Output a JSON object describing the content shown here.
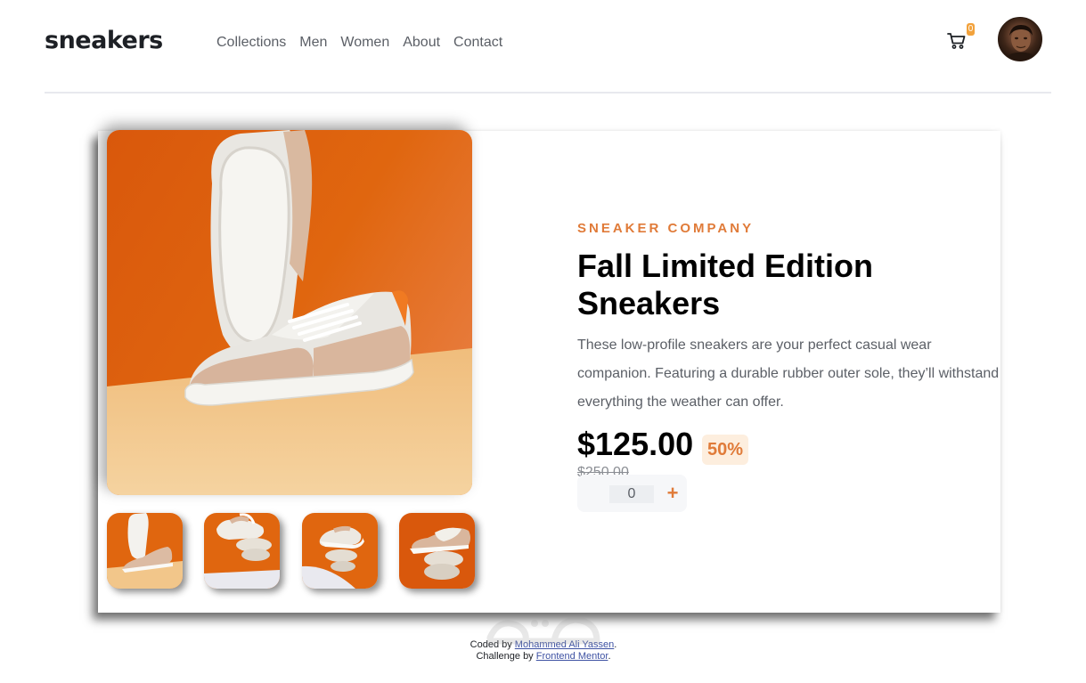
{
  "header": {
    "logo": "sneakers",
    "nav": [
      "Collections",
      "Men",
      "Women",
      "About",
      "Contact"
    ],
    "cart_count": "0"
  },
  "product": {
    "company": "SNEAKER COMPANY",
    "title": "Fall Limited Edition Sneakers",
    "description": "These low-profile sneakers are your perfect casual wear companion. Featuring a durable rubber outer sole, they’ll withstand everything the weather can offer.",
    "price": "$125.00",
    "discount": "50%",
    "original_price": "$250.00",
    "quantity": "0",
    "plus_symbol": "+"
  },
  "footer": {
    "coded_by_prefix": "Coded by",
    "coded_by_name": "Mohammed Ali Yassen",
    "challenge_prefix": "Challenge by",
    "challenge_name": "Frontend Mentor"
  },
  "icons": {
    "cart": "cart-icon",
    "plus": "plus-icon",
    "avatar": "user-avatar"
  },
  "colors": {
    "accent": "#e07b39",
    "accent_light": "#fdeede",
    "badge": "#f2a23c",
    "text_dark": "#1d2025",
    "text_muted": "#5b5f66"
  }
}
